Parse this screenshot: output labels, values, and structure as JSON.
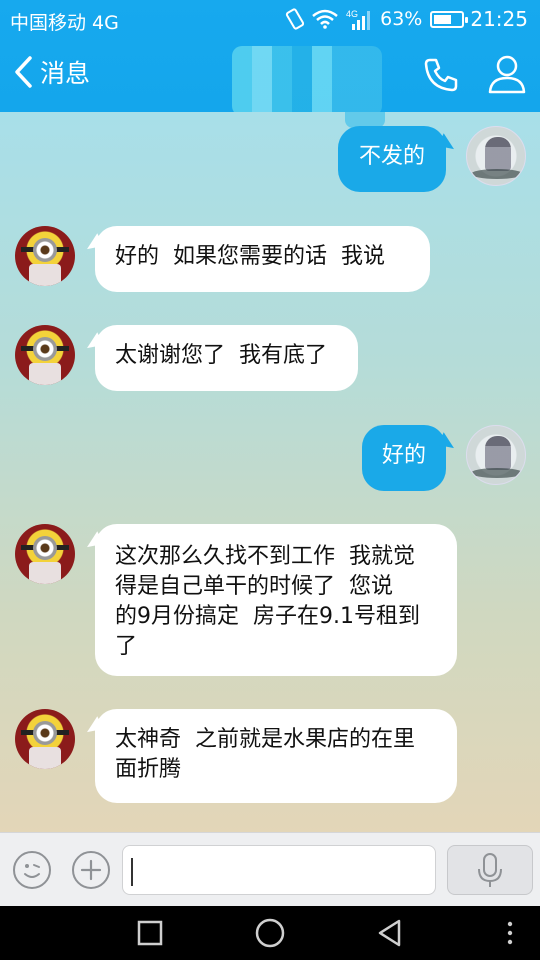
{
  "status_bar": {
    "carrier": "中国移动 4G",
    "network": "4G",
    "battery": "63%",
    "battery_level": 0.63,
    "time": "21:25"
  },
  "nav": {
    "back_label": "消息",
    "icons": {
      "back": "chevron-left-icon",
      "call": "phone-icon",
      "profile": "person-icon"
    }
  },
  "messages": [
    {
      "from": "self",
      "text": "不发的"
    },
    {
      "from": "contact",
      "text": "好的  如果您需要的话  我说"
    },
    {
      "from": "contact",
      "text": "太谢谢您了  我有底了"
    },
    {
      "from": "self",
      "text": "好的"
    },
    {
      "from": "contact",
      "lines": [
        "这次那么久找不到工作  我就觉",
        "得是自己单干的时候了  您说",
        "的9月份搞定  房子在9.1号租到",
        "了"
      ]
    },
    {
      "from": "contact",
      "lines": [
        "太神奇  之前就是水果店的在里",
        "面折腾"
      ]
    }
  ],
  "input_bar": {
    "value": "",
    "icons": {
      "emoji": "emoji-icon",
      "plus": "plus-icon",
      "voice": "microphone-icon"
    }
  },
  "system_nav": {
    "icons": [
      "recent-apps-icon",
      "home-icon",
      "back-icon",
      "more-icon"
    ]
  },
  "colors": {
    "header": "#17a9ee",
    "outgoing_bubble": "#1aa9e8",
    "incoming_bubble": "#ffffff"
  }
}
